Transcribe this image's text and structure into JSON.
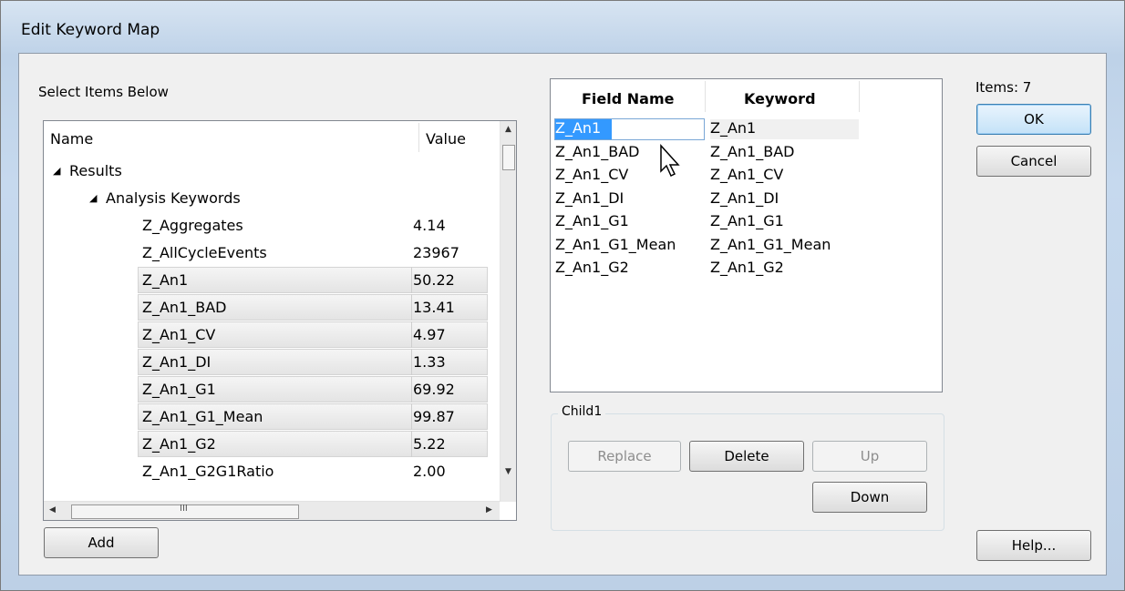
{
  "window": {
    "title": "Edit Keyword Map"
  },
  "left_panel": {
    "instruction": "Select Items Below",
    "columns": {
      "name": "Name",
      "value": "Value"
    },
    "tree_root": "Results",
    "tree_group": "Analysis Keywords",
    "items": [
      {
        "name": "Z_Aggregates",
        "value": "4.14",
        "selected": false
      },
      {
        "name": "Z_AllCycleEvents",
        "value": "23967",
        "selected": false
      },
      {
        "name": "Z_An1",
        "value": "50.22",
        "selected": true
      },
      {
        "name": "Z_An1_BAD",
        "value": "13.41",
        "selected": true
      },
      {
        "name": "Z_An1_CV",
        "value": "4.97",
        "selected": true
      },
      {
        "name": "Z_An1_DI",
        "value": "1.33",
        "selected": true
      },
      {
        "name": "Z_An1_G1",
        "value": "69.92",
        "selected": true
      },
      {
        "name": "Z_An1_G1_Mean",
        "value": "99.87",
        "selected": true
      },
      {
        "name": "Z_An1_G2",
        "value": "5.22",
        "selected": true
      },
      {
        "name": "Z_An1_G2G1Ratio",
        "value": "2.00",
        "selected": false
      }
    ],
    "add_label": "Add"
  },
  "map_list": {
    "columns": {
      "field": "Field Name",
      "keyword": "Keyword"
    },
    "rows": [
      {
        "field": "Z_An1",
        "keyword": "Z_An1"
      },
      {
        "field": "Z_An1_BAD",
        "keyword": "Z_An1_BAD"
      },
      {
        "field": "Z_An1_CV",
        "keyword": "Z_An1_CV"
      },
      {
        "field": "Z_An1_DI",
        "keyword": "Z_An1_DI"
      },
      {
        "field": "Z_An1_G1",
        "keyword": "Z_An1_G1"
      },
      {
        "field": "Z_An1_G1_Mean",
        "keyword": "Z_An1_G1_Mean"
      },
      {
        "field": "Z_An1_G2",
        "keyword": "Z_An1_G2"
      }
    ]
  },
  "group": {
    "label": "Child1",
    "replace": "Replace",
    "delete": "Delete",
    "up": "Up",
    "down": "Down"
  },
  "right_panel": {
    "items_count": "Items: 7",
    "ok": "OK",
    "cancel": "Cancel",
    "help": "Help..."
  },
  "colors": {
    "accent": "#3399ff",
    "title_bg": "#c8daf0"
  }
}
